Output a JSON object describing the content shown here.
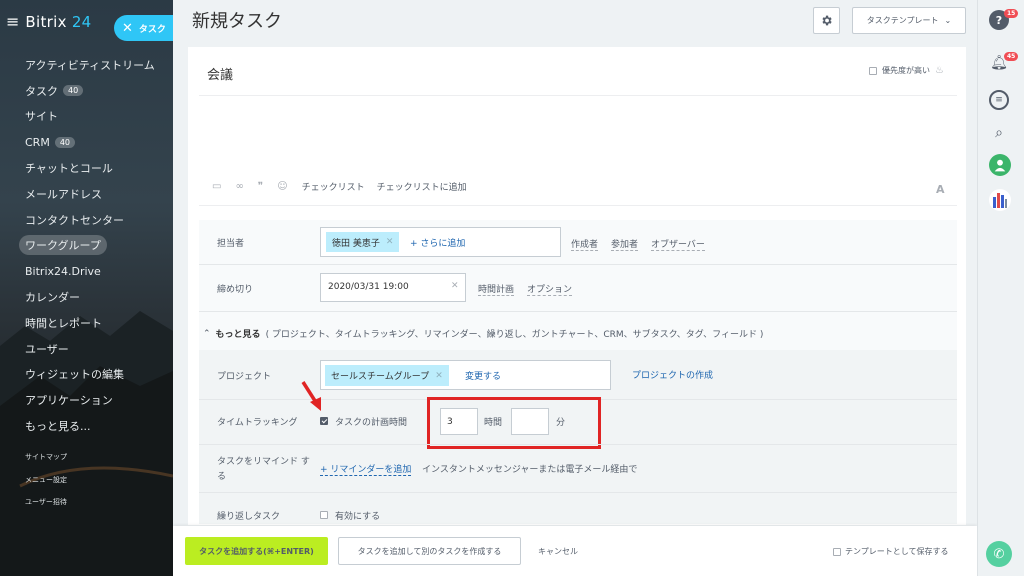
{
  "sidebar": {
    "logo_prefix": "Bitrix",
    "logo_suffix": "24",
    "task_pill_label": "タスク",
    "items": [
      {
        "label": "アクティビティストリーム",
        "count": ""
      },
      {
        "label": "タスク",
        "count": "40"
      },
      {
        "label": "サイト",
        "count": ""
      },
      {
        "label": "CRM",
        "count": "40"
      },
      {
        "label": "チャットとコール",
        "count": ""
      },
      {
        "label": "メールアドレス",
        "count": ""
      },
      {
        "label": "コンタクトセンター",
        "count": ""
      },
      {
        "label": "ワークグループ",
        "count": ""
      },
      {
        "label": "Bitrix24.Drive",
        "count": ""
      },
      {
        "label": "カレンダー",
        "count": ""
      },
      {
        "label": "時間とレポート",
        "count": ""
      },
      {
        "label": "ユーザー",
        "count": ""
      },
      {
        "label": "ウィジェットの編集",
        "count": ""
      },
      {
        "label": "アプリケーション",
        "count": ""
      },
      {
        "label": "もっと見る...",
        "count": ""
      }
    ],
    "small_links": [
      "サイトマップ",
      "メニュー設定",
      "ユーザー招待"
    ]
  },
  "header": {
    "title": "新規タスク",
    "template_button": "タスクテンプレート"
  },
  "task": {
    "title": "会議",
    "priority_label": "優先度が高い"
  },
  "toolbar": {
    "checklist": "チェックリスト",
    "add_checklist": "チェックリストに追加"
  },
  "form": {
    "assignee_label": "担当者",
    "assignee_name": "徳田 美恵子",
    "add_more": "+ さらに追加",
    "creator": "作成者",
    "participants": "参加者",
    "observers": "オブザーバー",
    "deadline_label": "締め切り",
    "deadline_value": "2020/03/31 19:00",
    "time_planning": "時間計画",
    "options": "オプション",
    "more_label": "もっと見る",
    "more_desc": "( プロジェクト、タイムトラッキング、リマインダー、繰り返し、ガントチャート、CRM、サブタスク、タグ、フィールド )",
    "project_label": "プロジェクト",
    "project_name": "セールスチームグループ",
    "change": "変更する",
    "create_project": "プロジェクトの作成",
    "time_tracking_label": "タイムトラッキング",
    "planned_time_label": "タスクの計画時間",
    "hours_value": "3",
    "hours_unit": "時間",
    "minutes_value": "",
    "minutes_unit": "分",
    "remind_label": "タスクをリマインド する",
    "add_reminder": "+ リマインダーを追加",
    "remind_desc": "インスタントメッセンジャーまたは電子メール経由で",
    "repeat_label": "繰り返しタスク",
    "repeat_enable": "有効にする"
  },
  "footer": {
    "add_task": "タスクを追加する(⌘+ENTER)",
    "add_and_create": "タスクを追加して別のタスクを作成する",
    "cancel": "キャンセル",
    "save_template": "テンプレートとして保存する"
  },
  "rightbar": {
    "help_badge": "15",
    "notif_badge": "45"
  },
  "colors": {
    "accent": "#2fc6f6",
    "primary_button": "#bbed21",
    "link": "#2067b0",
    "highlight_box": "#e02424"
  }
}
